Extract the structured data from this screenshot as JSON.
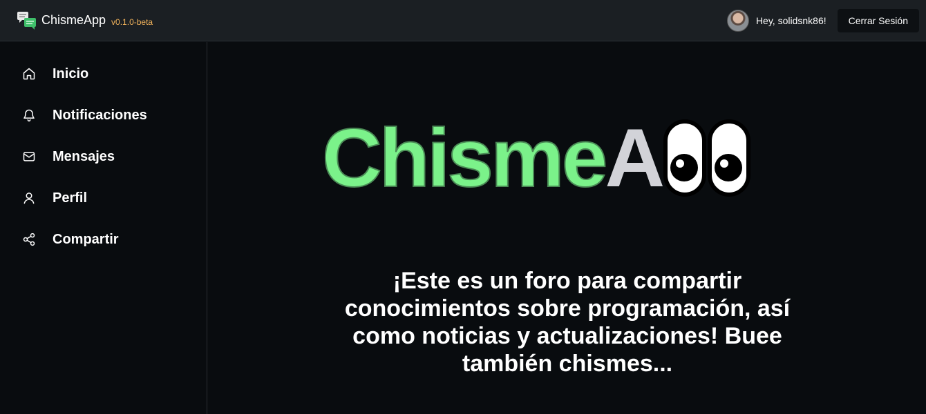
{
  "header": {
    "app_name": "ChismeApp",
    "version": "v0.1.0-beta",
    "greeting": "Hey, solidsnk86!",
    "logout_label": "Cerrar Sesión"
  },
  "sidebar": {
    "items": [
      {
        "label": "Inicio",
        "icon": "home-icon"
      },
      {
        "label": "Notificaciones",
        "icon": "bell-icon"
      },
      {
        "label": "Mensajes",
        "icon": "mail-icon"
      },
      {
        "label": "Perfil",
        "icon": "user-icon"
      },
      {
        "label": "Compartir",
        "icon": "share-icon"
      }
    ]
  },
  "hero": {
    "title_green": "Chisme",
    "title_gray": "A",
    "tagline": "¡Este es un foro para compartir conocimientos sobre programación, así como noticias y actualizaciones! Buee también chismes..."
  },
  "colors": {
    "background": "#090c0f",
    "header": "#1b1f23",
    "brand_green": "#7bf28a",
    "version_orange": "#f2b35b",
    "title_gray": "#d2d3d8"
  }
}
